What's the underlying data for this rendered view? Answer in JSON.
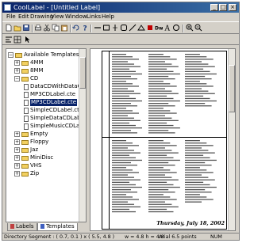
{
  "window": {
    "title": "CoolLabel - [Untitled Label]",
    "app_icon": "app-icon"
  },
  "caption_buttons": {
    "minimize": "_",
    "maximize": "□",
    "close": "×"
  },
  "menu": [
    "File",
    "Edit",
    "Drawing",
    "View",
    "Window",
    "Links",
    "Help"
  ],
  "toolbar": {
    "icons": [
      "new-icon",
      "open-icon",
      "save-icon",
      "print-icon",
      "cut-icon",
      "copy-icon",
      "paste-icon",
      "undo-icon",
      "help-icon",
      "line-tool-icon",
      "rectangle-tool-icon",
      "rounded-rect-tool-icon",
      "ellipse-tool-icon",
      "line-draw-icon",
      "stop-icon",
      "dw-text-icon",
      "text-tool-icon",
      "circle-tool-icon",
      "zoom-in-icon",
      "zoom-out-icon"
    ],
    "row2_icons": [
      "align-icon",
      "grid-icon",
      "pointer-icon"
    ]
  },
  "tree": {
    "root": "Available Templates",
    "items": [
      {
        "label": "4MM",
        "type": "folder",
        "expander": "+"
      },
      {
        "label": "8MM",
        "type": "folder",
        "expander": "+"
      },
      {
        "label": "CD",
        "type": "folder",
        "expander": "−"
      },
      {
        "label": "DataCDWithDataOnBack",
        "type": "file"
      },
      {
        "label": "MP3CDLabel.cte",
        "type": "file"
      },
      {
        "label": "MP3CDLabel.cte",
        "type": "file",
        "selected": true
      },
      {
        "label": "SimpleCDLabel.cte",
        "type": "file"
      },
      {
        "label": "SimpleDataCDLabel.cte",
        "type": "file"
      },
      {
        "label": "SimpleMusicCDLabel.cte",
        "type": "file"
      },
      {
        "label": "Empty",
        "type": "folder",
        "expander": "+"
      },
      {
        "label": "Floppy",
        "type": "folder",
        "expander": "+"
      },
      {
        "label": "Jaz",
        "type": "folder",
        "expander": "+"
      },
      {
        "label": "MiniDisc",
        "type": "folder",
        "expander": "+"
      },
      {
        "label": "VHS",
        "type": "folder",
        "expander": "+"
      },
      {
        "label": "Zip",
        "type": "folder",
        "expander": "+"
      }
    ]
  },
  "tabs": [
    {
      "label": "Labels",
      "active": false
    },
    {
      "label": "Templates",
      "active": true
    }
  ],
  "label_preview": {
    "footer_date": "Thursday, July 18, 2002"
  },
  "status": {
    "segment": "Directory Segment : ( 0.7, 0.1 ) x ( 5.5, 4.8 )",
    "size": "w = 4.8 h = 4.8",
    "font": "Arial  6.5 points",
    "num": "NUM"
  }
}
